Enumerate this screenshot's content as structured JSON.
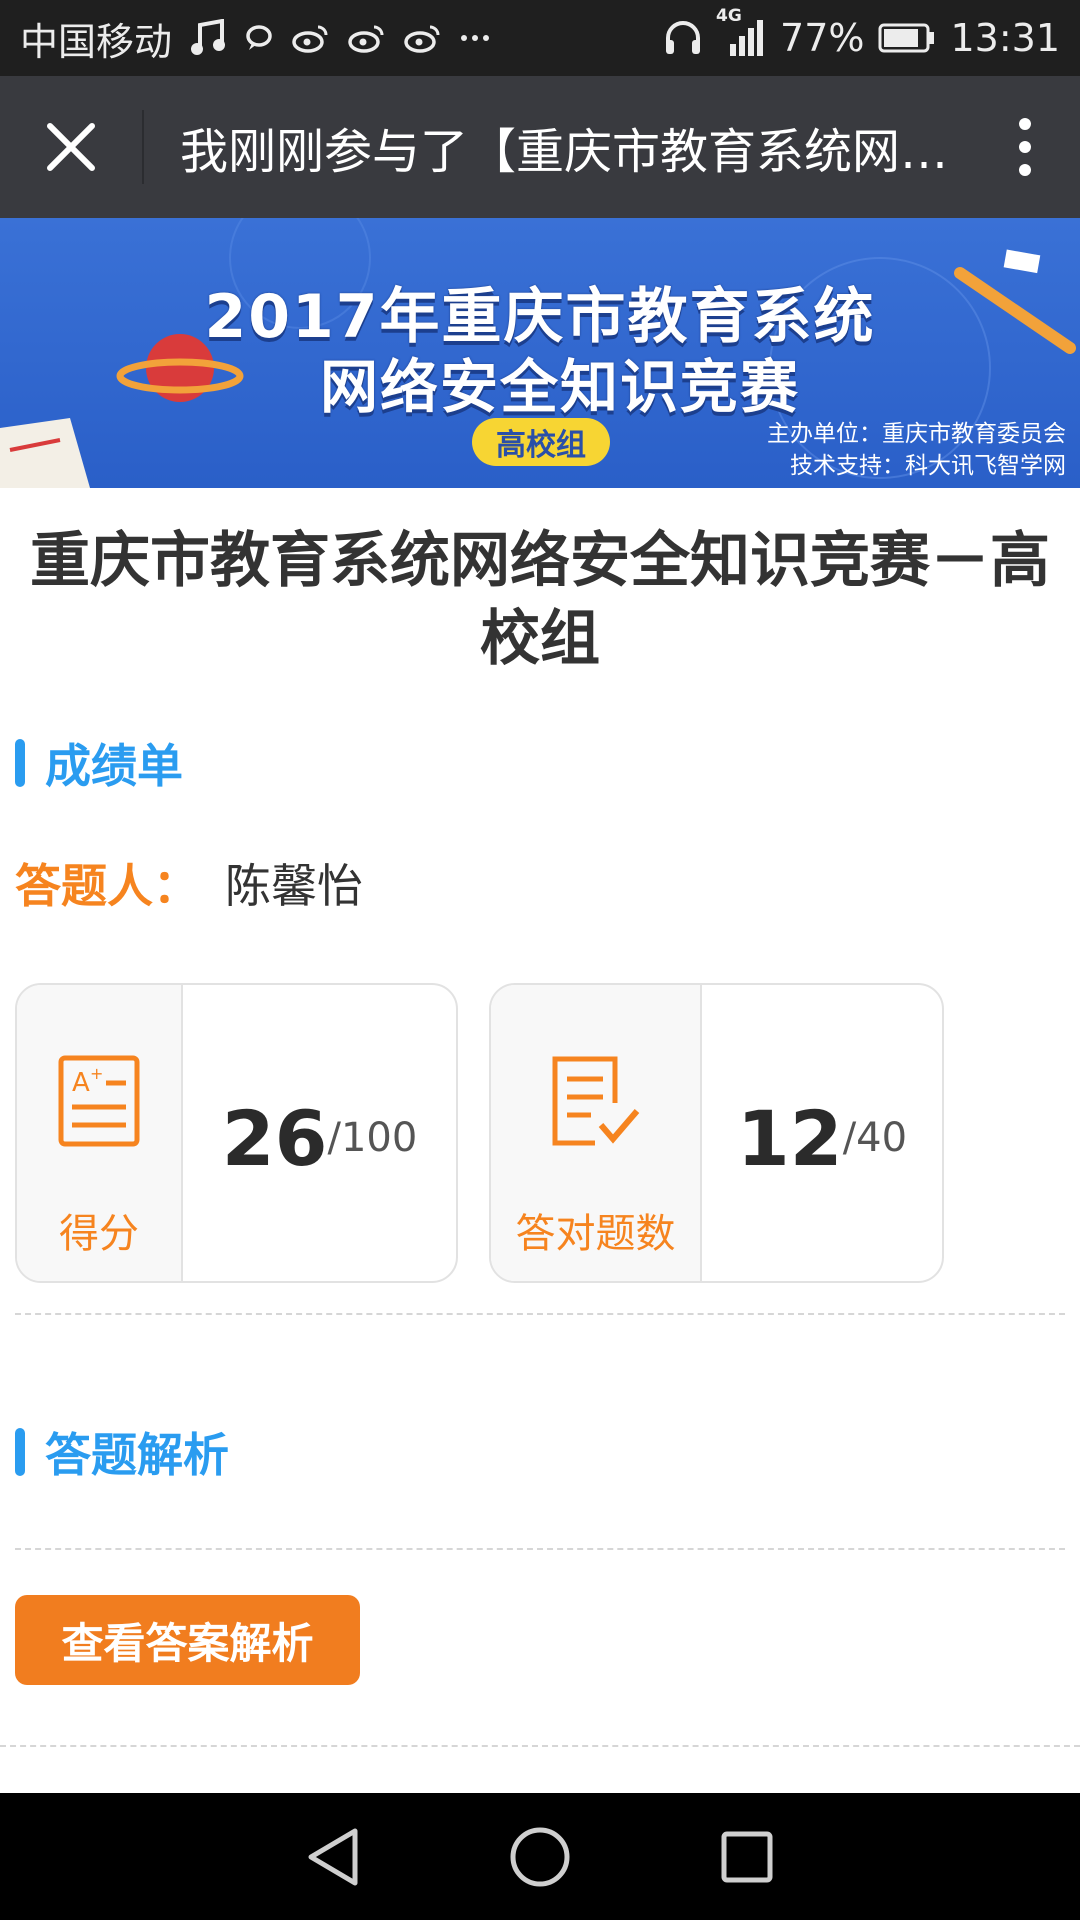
{
  "status_bar": {
    "carrier": "中国移动",
    "network": "4G",
    "battery": "77%",
    "time": "13:31"
  },
  "title_bar": {
    "title": "我刚刚参与了【重庆市教育系统网络安全知识竞赛..."
  },
  "banner": {
    "line1": "2017年重庆市教育系统",
    "line2": "网络安全知识竞赛",
    "badge": "高校组",
    "organizer": "主办单位：重庆市教育委员会",
    "tech_support": "技术支持：科大讯飞智学网"
  },
  "page_title": "重庆市教育系统网络安全知识竞赛－高校组",
  "score_section": {
    "heading": "成绩单",
    "respondent_label": "答题人：",
    "respondent_name": "陈馨怡",
    "cards": [
      {
        "icon": "grade-sheet-icon",
        "label": "得分",
        "value": "26",
        "total": "/100"
      },
      {
        "icon": "checklist-icon",
        "label": "答对题数",
        "value": "12",
        "total": "/40"
      }
    ]
  },
  "analysis_section": {
    "heading": "答题解析",
    "button_label": "查看答案解析"
  },
  "colors": {
    "accent_blue": "#2a9cf0",
    "accent_orange": "#f6841f",
    "title_bar": "#393a3f"
  }
}
